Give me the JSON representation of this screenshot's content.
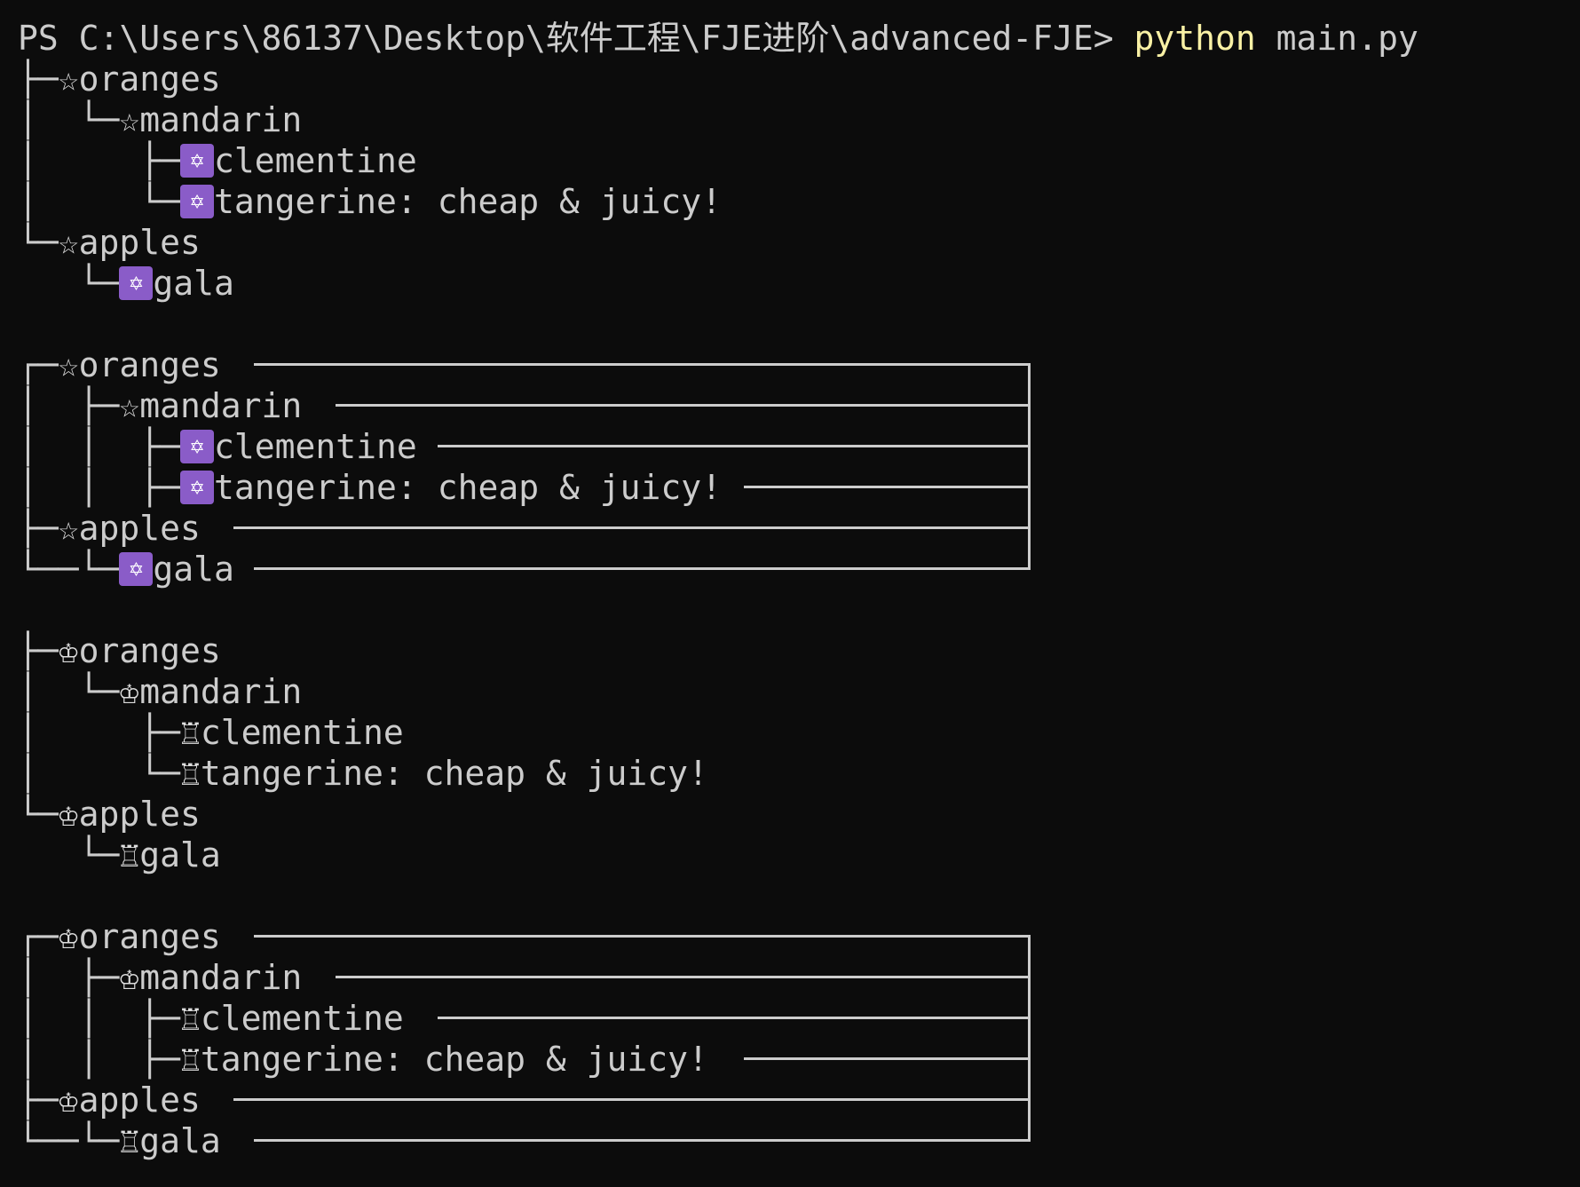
{
  "prompt": {
    "path": "PS C:\\Users\\86137\\Desktop\\软件工程\\FJE进阶\\advanced-FJE> ",
    "command": "python",
    "argument": " main.py"
  },
  "icons": {
    "container_star": "☆",
    "leaf_star_badge": "✡",
    "container_chess": "♔",
    "leaf_chess": "♖",
    "leaf_badge_color": "#8a5cc8",
    "command_color": "#f9f1a5",
    "text_color": "#cccccc",
    "background": "#0c0c0c"
  },
  "outputs": [
    {
      "style": "tree",
      "icon_family": "poker",
      "rows": [
        {
          "prefix": "├─",
          "icon": "☆",
          "text": "oranges"
        },
        {
          "prefix": "│  └─",
          "icon": "☆",
          "text": "mandarin"
        },
        {
          "prefix": "│     ├─",
          "icon": "✡",
          "text": "clementine"
        },
        {
          "prefix": "│     └─",
          "icon": "✡",
          "text": "tangerine: cheap & juicy!"
        },
        {
          "prefix": "└─",
          "icon": "☆",
          "text": "apples"
        },
        {
          "prefix": "   └─",
          "icon": "✡",
          "text": "gala"
        }
      ]
    },
    {
      "style": "rectangle",
      "icon_family": "poker",
      "rows": [
        {
          "prefix": "┌─",
          "icon": "☆",
          "text": "oranges"
        },
        {
          "prefix": "│  ├─",
          "icon": "☆",
          "text": "mandarin"
        },
        {
          "prefix": "│  │  ├─",
          "icon": "✡",
          "text": "clementine"
        },
        {
          "prefix": "│  │  ├─",
          "icon": "✡",
          "text": "tangerine: cheap & juicy!"
        },
        {
          "prefix": "├─",
          "icon": "☆",
          "text": "apples"
        },
        {
          "prefix": "└──└─",
          "icon": "✡",
          "text": "gala"
        }
      ]
    },
    {
      "style": "tree",
      "icon_family": "chess",
      "rows": [
        {
          "prefix": "├─",
          "icon": "♔",
          "text": "oranges"
        },
        {
          "prefix": "│  └─",
          "icon": "♔",
          "text": "mandarin"
        },
        {
          "prefix": "│     ├─",
          "icon": "♖",
          "text": "clementine"
        },
        {
          "prefix": "│     └─",
          "icon": "♖",
          "text": "tangerine: cheap & juicy!"
        },
        {
          "prefix": "└─",
          "icon": "♔",
          "text": "apples"
        },
        {
          "prefix": "   └─",
          "icon": "♖",
          "text": "gala"
        }
      ]
    },
    {
      "style": "rectangle",
      "icon_family": "chess",
      "rows": [
        {
          "prefix": "┌─",
          "icon": "♔",
          "text": "oranges"
        },
        {
          "prefix": "│  ├─",
          "icon": "♔",
          "text": "mandarin"
        },
        {
          "prefix": "│  │  ├─",
          "icon": "♖",
          "text": "clementine"
        },
        {
          "prefix": "│  │  ├─",
          "icon": "♖",
          "text": "tangerine: cheap & juicy!"
        },
        {
          "prefix": "├─",
          "icon": "♔",
          "text": "apples"
        },
        {
          "prefix": "└──└─",
          "icon": "♖",
          "text": "gala"
        }
      ]
    }
  ]
}
